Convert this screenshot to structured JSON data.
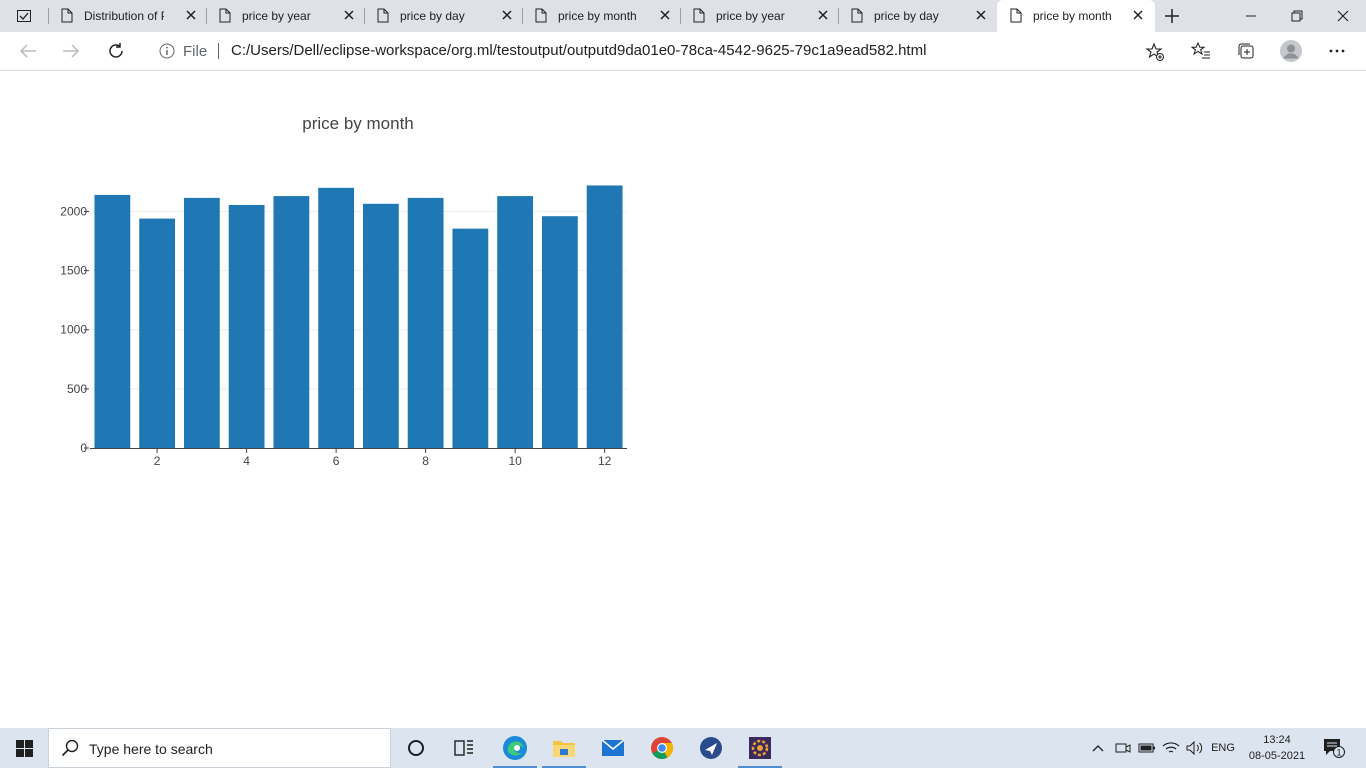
{
  "browser": {
    "tabs": [
      {
        "label": "Distribution of Pri",
        "active": false
      },
      {
        "label": "price by year",
        "active": false
      },
      {
        "label": "price by day",
        "active": false
      },
      {
        "label": "price by month",
        "active": false
      },
      {
        "label": "price by year",
        "active": false
      },
      {
        "label": "price by day",
        "active": false
      },
      {
        "label": "price by month",
        "active": true
      }
    ],
    "address": {
      "scheme_label": "File",
      "url": "C:/Users/Dell/eclipse-workspace/org.ml/testoutput/outputd9da01e0-78ca-4542-9625-79c1a9ead582.html"
    }
  },
  "chart_data": {
    "type": "bar",
    "title": "price by month",
    "xlabel": "",
    "ylabel": "",
    "x": [
      1,
      2,
      3,
      4,
      5,
      6,
      7,
      8,
      9,
      10,
      11,
      12
    ],
    "values": [
      2140,
      1940,
      2115,
      2055,
      2130,
      2200,
      2065,
      2115,
      1855,
      2130,
      1960,
      2220
    ],
    "xticks": [
      "2",
      "4",
      "6",
      "8",
      "10",
      "12"
    ],
    "xtick_values": [
      2,
      4,
      6,
      8,
      10,
      12
    ],
    "yticks": [
      "0",
      "500",
      "1000",
      "1500",
      "2000"
    ],
    "ytick_values": [
      0,
      500,
      1000,
      1500,
      2000
    ],
    "xlim": [
      0.5,
      12.5
    ],
    "ylim": [
      0,
      2300
    ],
    "grid": true,
    "bar_color": "#1f77b4"
  },
  "taskbar": {
    "search_placeholder": "Type here to search",
    "language": "ENG",
    "time": "13:24",
    "date": "08-05-2021",
    "notification_count": "1"
  },
  "colors": {
    "tabstrip_bg": "#dee1e6",
    "taskbar_bg": "#dbe4ef",
    "accent": "#1f77b4"
  }
}
